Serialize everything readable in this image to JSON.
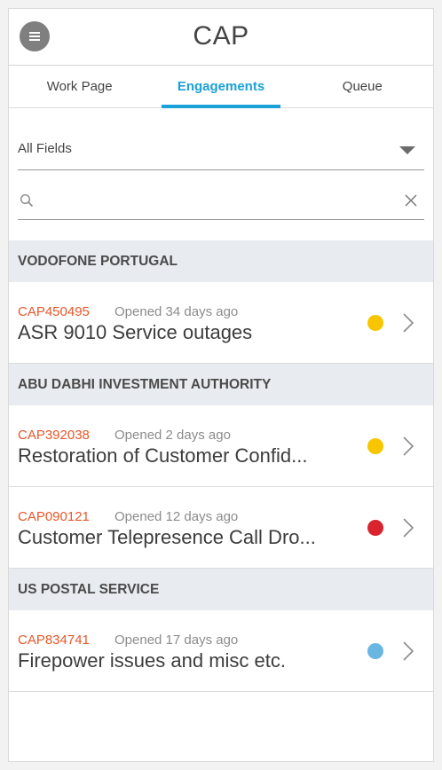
{
  "app": {
    "title": "CAP"
  },
  "tabs": [
    {
      "label": "Work Page",
      "active": false
    },
    {
      "label": "Engagements",
      "active": true
    },
    {
      "label": "Queue",
      "active": false
    }
  ],
  "filter": {
    "selected": "All Fields"
  },
  "search": {
    "value": "",
    "placeholder": ""
  },
  "colors": {
    "accent": "#1aa1d8",
    "case_id": "#e8572a",
    "yellow": "#f7c600",
    "red": "#d9232e",
    "blue": "#6ab6e3"
  },
  "groups": [
    {
      "name": "VODOFONE PORTUGAL",
      "items": [
        {
          "id": "CAP450495",
          "opened": "Opened 34 days ago",
          "title": "ASR 9010 Service outages",
          "status": "yellow"
        }
      ]
    },
    {
      "name": "ABU DABHI INVESTMENT AUTHORITY",
      "items": [
        {
          "id": "CAP392038",
          "opened": "Opened 2 days ago",
          "title": "Restoration of Customer Confid...",
          "status": "yellow"
        },
        {
          "id": "CAP090121",
          "opened": "Opened 12 days ago",
          "title": "Customer Telepresence Call Dro...",
          "status": "red"
        }
      ]
    },
    {
      "name": "US POSTAL SERVICE",
      "items": [
        {
          "id": "CAP834741",
          "opened": "Opened 17 days ago",
          "title": "Firepower issues and misc etc.",
          "status": "blue"
        }
      ]
    }
  ]
}
